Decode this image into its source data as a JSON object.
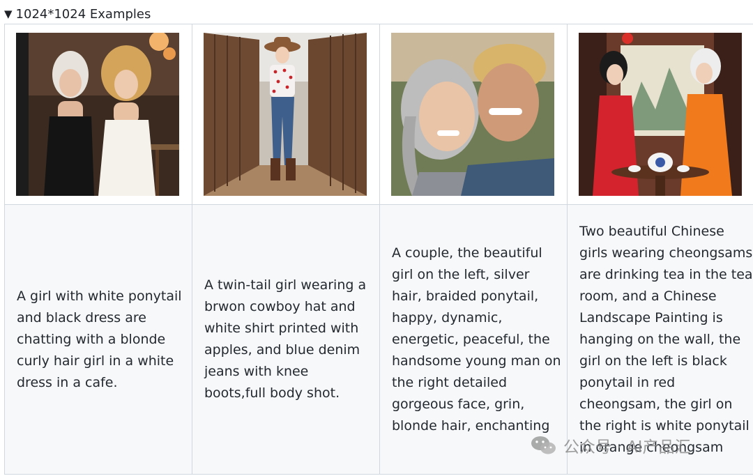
{
  "details": {
    "triangle": "▼",
    "summary": "1024*1024 Examples"
  },
  "examples": [
    {
      "image_name": "girls-cafe-image",
      "caption": "A girl with white ponytail and black dress are chatting with a blonde curly hair girl in a white dress in a cafe."
    },
    {
      "image_name": "cowboy-girl-image",
      "caption": "A twin-tail girl wearing a brwon cowboy hat and white shirt printed with apples, and blue denim jeans with knee boots,full body shot."
    },
    {
      "image_name": "couple-image",
      "caption": "A couple, the beautiful girl on the left, silver hair, braided ponytail, happy, dynamic, energetic, peaceful, the handsome young man on the right detailed gorgeous face, grin, blonde hair, enchanting"
    },
    {
      "image_name": "cheongsam-girls-image",
      "caption": "Two beautiful Chinese girls wearing cheongsams are drinking tea in the tea room, and a Chinese Landscape Painting is hanging on the wall, the girl on the left is black ponytail in red cheongsam, the girl on the right is white ponytail in orange cheongsam"
    }
  ],
  "watermark": {
    "text": "公众号 · AI产品汇",
    "icon": "wechat-icon"
  }
}
